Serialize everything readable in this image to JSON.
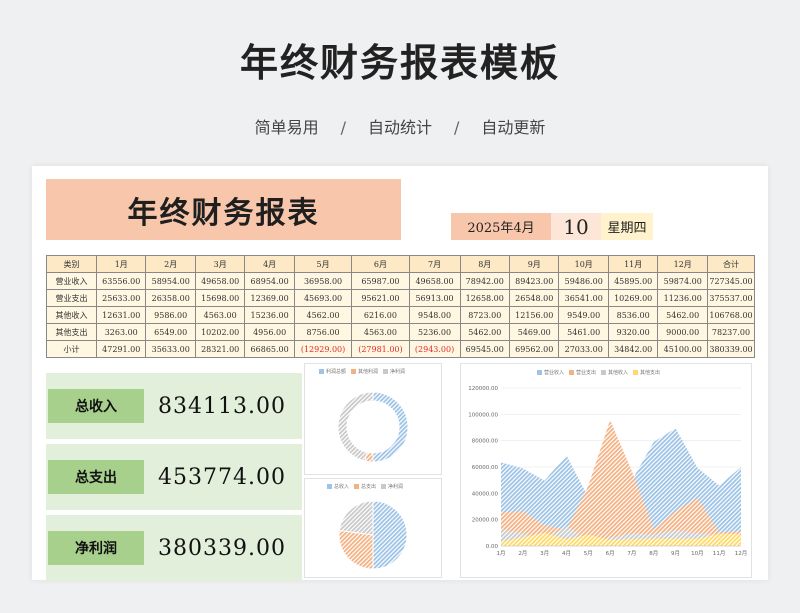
{
  "page": {
    "title": "年终财务报表模板",
    "subtitle": [
      "简单易用",
      "自动统计",
      "自动更新"
    ],
    "separator": "/"
  },
  "sheet": {
    "title": "年终财务报表",
    "year_month": "2025年4月",
    "day": "10",
    "weekday": "星期四"
  },
  "table": {
    "headers": [
      "类别",
      "1月",
      "2月",
      "3月",
      "4月",
      "5月",
      "6月",
      "7月",
      "8月",
      "9月",
      "10月",
      "11月",
      "12月",
      "合计"
    ],
    "rows": [
      [
        "营业收入",
        "63556.00",
        "58954.00",
        "49658.00",
        "68954.00",
        "36958.00",
        "65987.00",
        "49658.00",
        "78942.00",
        "89423.00",
        "59486.00",
        "45895.00",
        "59874.00",
        "727345.00"
      ],
      [
        "营业支出",
        "25633.00",
        "26358.00",
        "15698.00",
        "12369.00",
        "45693.00",
        "95621.00",
        "56913.00",
        "12658.00",
        "26548.00",
        "36541.00",
        "10269.00",
        "11236.00",
        "375537.00"
      ],
      [
        "其他收入",
        "12631.00",
        "9586.00",
        "4563.00",
        "15236.00",
        "4562.00",
        "6216.00",
        "9548.00",
        "8723.00",
        "12156.00",
        "9549.00",
        "8536.00",
        "5462.00",
        "106768.00"
      ],
      [
        "其他支出",
        "3263.00",
        "6549.00",
        "10202.00",
        "4956.00",
        "8756.00",
        "4563.00",
        "5236.00",
        "5462.00",
        "5469.00",
        "5461.00",
        "9320.00",
        "9000.00",
        "78237.00"
      ],
      [
        "小计",
        "47291.00",
        "35633.00",
        "28321.00",
        "66865.00",
        "(12929.00)",
        "(27981.00)",
        "(2943.00)",
        "69545.00",
        "69562.00",
        "27033.00",
        "34842.00",
        "45100.00",
        "380339.00"
      ]
    ]
  },
  "summary": [
    {
      "label": "总收入",
      "value": "834113.00"
    },
    {
      "label": "总支出",
      "value": "453774.00"
    },
    {
      "label": "净利润",
      "value": "380339.00"
    }
  ],
  "colors": {
    "revenue": "#9dc3e6",
    "expense": "#f4b183",
    "other_income": "#c9c9c9",
    "other_expense": "#ffd966",
    "negative_text": "#e02c2c",
    "header_bg": "#f8c7ab",
    "table_header_bg": "#fde9c6",
    "stat_bg": "#e1efdb",
    "stat_label_bg": "#a8d08d"
  },
  "chart_data": [
    {
      "type": "pie",
      "variant": "doughnut",
      "legend": [
        "利润总额",
        "其他利润",
        "净利润"
      ],
      "legend_position": "top",
      "values": [
        351808,
        28531,
        380339
      ]
    },
    {
      "type": "pie",
      "legend": [
        "总收入",
        "总支出",
        "净利润"
      ],
      "legend_position": "top",
      "values": [
        834113,
        453774,
        380339
      ]
    },
    {
      "type": "area",
      "categories": [
        "1月",
        "2月",
        "3月",
        "4月",
        "5月",
        "6月",
        "7月",
        "8月",
        "9月",
        "10月",
        "11月",
        "12月"
      ],
      "series": [
        {
          "name": "营业收入",
          "values": [
            63556,
            58954,
            49658,
            68954,
            36958,
            65987,
            49658,
            78942,
            89423,
            59486,
            45895,
            59874
          ]
        },
        {
          "name": "营业支出",
          "values": [
            25633,
            26358,
            15698,
            12369,
            45693,
            95621,
            56913,
            12658,
            26548,
            36541,
            10269,
            11236
          ]
        },
        {
          "name": "其他收入",
          "values": [
            12631,
            9586,
            4563,
            15236,
            4562,
            6216,
            9548,
            8723,
            12156,
            9549,
            8536,
            5462
          ]
        },
        {
          "name": "其他支出",
          "values": [
            3263,
            6549,
            10202,
            4956,
            8756,
            4563,
            5236,
            5462,
            5469,
            5461,
            9320,
            9000
          ]
        }
      ],
      "ylim": [
        0,
        120000
      ],
      "yticks": [
        "0.00",
        "20000.00",
        "40000.00",
        "60000.00",
        "80000.00",
        "100000.00",
        "120000.00"
      ],
      "legend_position": "top",
      "grid": true
    }
  ]
}
